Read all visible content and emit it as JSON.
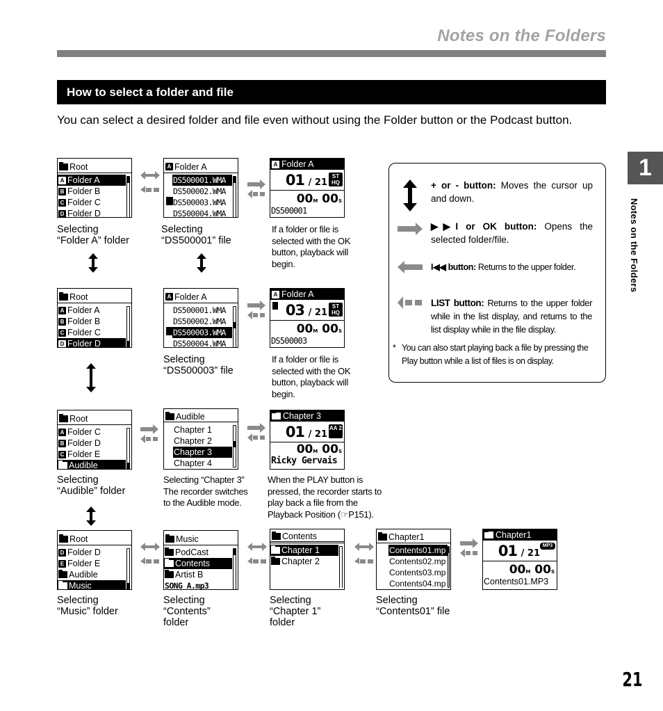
{
  "page": {
    "title": "Notes on the Folders",
    "section_heading": "How to select a folder and file",
    "intro": "You can select a desired folder and file even without using the Folder button or the Podcast button.",
    "chapter_tab": "1",
    "side_label": "Notes on the Folders",
    "page_number": "21"
  },
  "screens": {
    "root_a": {
      "header": "Root",
      "rows": [
        {
          "badge": "A",
          "label": "Folder  A",
          "selected": true
        },
        {
          "badge": "B",
          "label": "Folder  B"
        },
        {
          "badge": "C",
          "label": "Folder  C"
        },
        {
          "badge": "D",
          "label": "Folder  D"
        }
      ],
      "caption": "Selecting\n“Folder A” folder"
    },
    "folder_a_1": {
      "header_badge": "A",
      "header": "Folder  A",
      "rows": [
        "DS500001.WMA",
        "DS500002.WMA",
        "DS500003.WMA",
        "DS500004.WMA"
      ],
      "caption": "Selecting\n“DS500001” file"
    },
    "play_1": {
      "header_badge": "A",
      "header": "Folder  A",
      "track": "01",
      "total": "21",
      "mode": "ST HQ",
      "time_m": "00",
      "time_s": "00",
      "file": "DS500001",
      "caption": "If a folder or file is selected with the OK button, playback will begin."
    },
    "root_d": {
      "header": "Root",
      "rows": [
        {
          "badge": "A",
          "label": "Folder  A"
        },
        {
          "badge": "B",
          "label": "Folder  B"
        },
        {
          "badge": "C",
          "label": "Folder  C"
        },
        {
          "badge": "D",
          "label": "Folder  D",
          "selected": true
        }
      ]
    },
    "folder_a_3": {
      "header_badge": "A",
      "header": "Folder  A",
      "rows": [
        "DS500001.WMA",
        "DS500002.WMA",
        "DS500003.WMA",
        "DS500004.WMA"
      ],
      "caption": "Selecting\n“DS500003” file"
    },
    "play_3": {
      "header_badge": "A",
      "header": "Folder  A",
      "track": "03",
      "total": "21",
      "mode": "ST HQ",
      "time_m": "00",
      "time_s": "00",
      "file": "DS500003",
      "caption": "If a folder or file is selected with the OK button, playback will begin."
    },
    "root_audible": {
      "header": "Root",
      "rows": [
        {
          "badge": "A",
          "label": "Folder  C"
        },
        {
          "badge": "B",
          "label": "Folder  D"
        },
        {
          "badge": "C",
          "label": "Folder  E"
        },
        {
          "badge": "",
          "label": "Audible",
          "selected": true
        }
      ],
      "caption": "Selecting\n“Audible” folder"
    },
    "audible": {
      "header": "Audible",
      "rows": [
        "Chapter 1",
        "Chapter 2",
        "Chapter 3",
        "Chapter 4"
      ],
      "caption": "Selecting “Chapter 3” The recorder switches to the Audible mode."
    },
    "play_chapter3": {
      "header": "Chapter 3",
      "track": "01",
      "total": "21",
      "mode": "AA 2",
      "time_m": "00",
      "time_s": "00",
      "file": "Ricky Gervais",
      "caption": "When the PLAY button is pressed, the recorder starts to play back a file from the Playback Position (☞P151)."
    },
    "root_music": {
      "header": "Root",
      "rows": [
        {
          "badge": "D",
          "label": "Folder  D"
        },
        {
          "badge": "E",
          "label": "Folder  E"
        },
        {
          "badge": "",
          "label": "Audible"
        },
        {
          "badge": "",
          "label": "Music",
          "selected": true
        }
      ],
      "caption": "Selecting\n“Music” folder"
    },
    "music": {
      "header": "Music",
      "rows": [
        "PodCast",
        "Contents",
        "Artist  B",
        "SONG A.mp3"
      ],
      "caption": "Selecting\n“Contents”\nfolder"
    },
    "contents": {
      "header": "Contents",
      "rows": [
        "Chapter 1",
        "Chapter 2"
      ],
      "caption": "Selecting\n“Chapter 1”\nfolder"
    },
    "chapter1_list": {
      "header": "Chapter1",
      "rows": [
        "Contents01.mp",
        "Contents02.mp",
        "Contents03.mp",
        "Contents04.mp"
      ],
      "caption": "Selecting\n“Contents01” file"
    },
    "play_contents01": {
      "header": "Chapter1",
      "track": "01",
      "total": "21",
      "mode": "MP3",
      "time_m": "00",
      "time_s": "00",
      "file": "Contents01.MP3"
    }
  },
  "legend": {
    "plus_minus": {
      "key": "+ or - button:",
      "text": "Moves the cursor up and down."
    },
    "ok": {
      "key": "▶▶I  or  OK  button:",
      "text": "Opens the selected folder/file."
    },
    "back": {
      "key": "I◀◀  button:",
      "text": "Returns to the upper folder."
    },
    "list": {
      "key": "LIST  button:",
      "text": "Returns to the upper folder while in the list display, and returns to the list display while in the file display."
    },
    "note_mark": "*",
    "note": "You can also start playing back a file by pressing the Play button while a list of files is on display."
  }
}
